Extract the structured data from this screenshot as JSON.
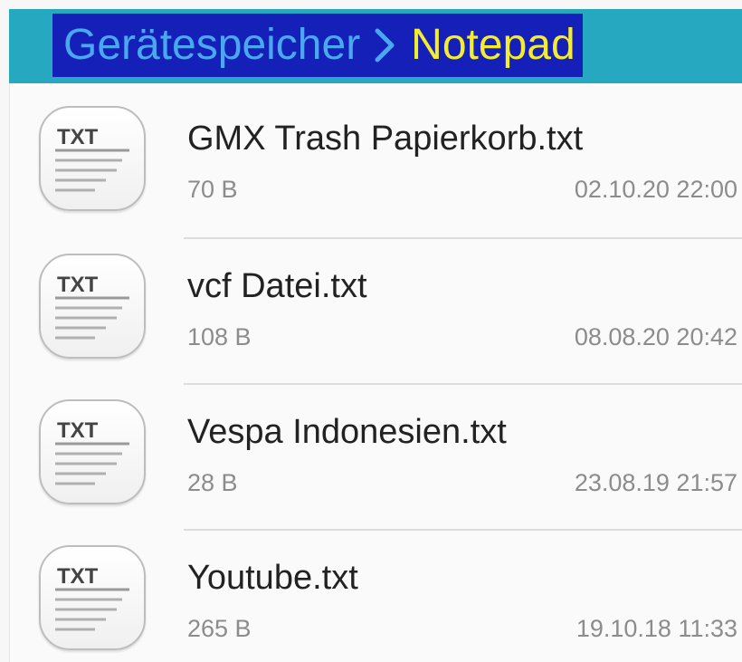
{
  "header": {
    "breadcrumb_root": "Gerätespeicher",
    "breadcrumb_current": "Notepad",
    "separator_icon": "chevron-right-icon",
    "bar_color": "#25a8c0",
    "highlight_color": "#1520b8",
    "root_color": "#4aa8f0",
    "current_color": "#f4ec30"
  },
  "files": [
    {
      "icon": "txt-file-icon",
      "icon_label": "TXT",
      "name": "GMX Trash Papierkorb.txt",
      "size": "70 B",
      "date": "02.10.20 22:00"
    },
    {
      "icon": "txt-file-icon",
      "icon_label": "TXT",
      "name": "vcf Datei.txt",
      "size": "108 B",
      "date": "08.08.20 20:42"
    },
    {
      "icon": "txt-file-icon",
      "icon_label": "TXT",
      "name": "Vespa Indonesien.txt",
      "size": "28 B",
      "date": "23.08.19 21:57"
    },
    {
      "icon": "txt-file-icon",
      "icon_label": "TXT",
      "name": "Youtube.txt",
      "size": "265 B",
      "date": "19.10.18 11:33"
    }
  ]
}
